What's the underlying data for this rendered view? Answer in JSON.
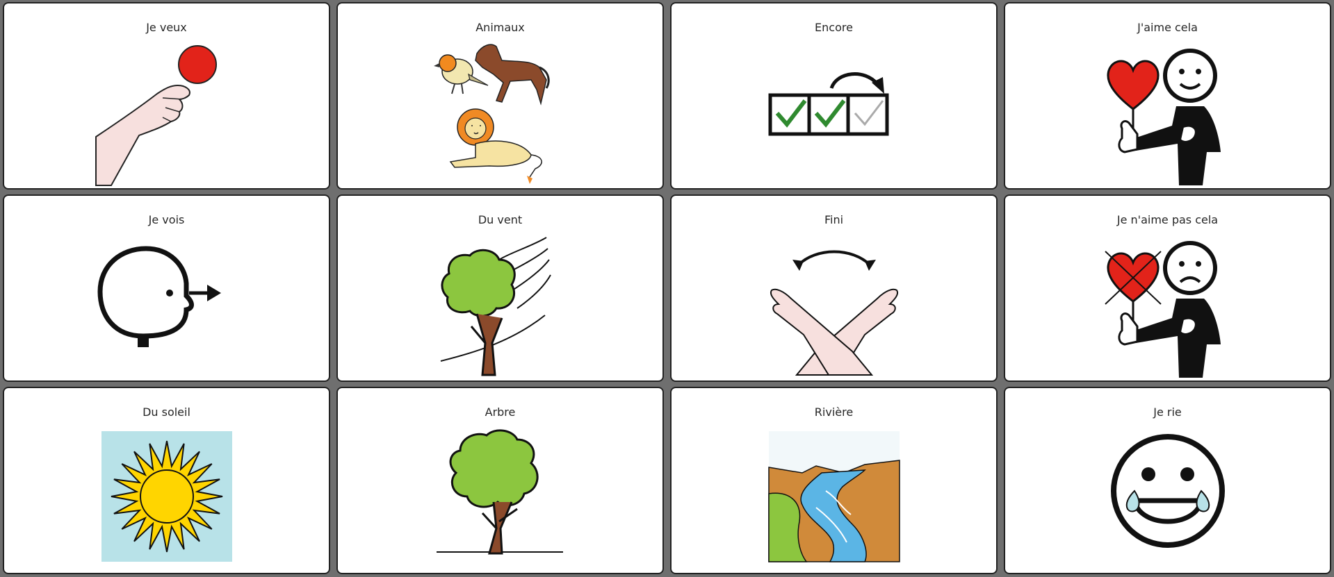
{
  "board": {
    "tiles": [
      {
        "label": "Je veux",
        "icon": "want-icon"
      },
      {
        "label": "Animaux",
        "icon": "animals-icon"
      },
      {
        "label": "Encore",
        "icon": "more-icon"
      },
      {
        "label": "J'aime cela",
        "icon": "like-icon"
      },
      {
        "label": "Je vois",
        "icon": "see-icon"
      },
      {
        "label": "Du vent",
        "icon": "wind-icon"
      },
      {
        "label": "Fini",
        "icon": "finished-icon"
      },
      {
        "label": "Je n'aime pas cela",
        "icon": "dislike-icon"
      },
      {
        "label": "Du soleil",
        "icon": "sun-icon"
      },
      {
        "label": "Arbre",
        "icon": "tree-icon"
      },
      {
        "label": "Rivière",
        "icon": "river-icon"
      },
      {
        "label": "Je rie",
        "icon": "laugh-icon"
      }
    ]
  },
  "colors": {
    "background": "#6f6f6f",
    "tile": "#ffffff",
    "border": "#222222",
    "heart": "#e2231a",
    "leaf": "#8cc63f",
    "sun": "#ffd500",
    "sky": "#b8e2e8",
    "water": "#5bb5e5"
  }
}
